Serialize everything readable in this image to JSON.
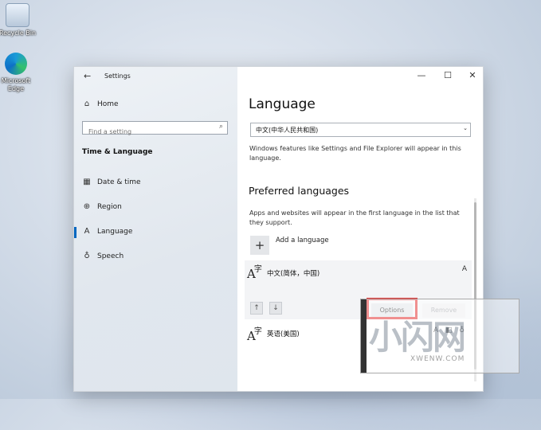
{
  "desktop": {
    "icons": [
      {
        "label": "Recycle Bin"
      },
      {
        "label": "Microsoft Edge"
      }
    ]
  },
  "window": {
    "title": "Settings",
    "back_symbol": "←",
    "minimize_symbol": "—",
    "maximize_symbol": "☐",
    "close_symbol": "✕"
  },
  "sidebar": {
    "home_label": "Home",
    "search_placeholder": "Find a setting",
    "section_title": "Time & Language",
    "items": [
      {
        "label": "Date & time",
        "icon": "calendar-icon",
        "glyph": "▦"
      },
      {
        "label": "Region",
        "icon": "globe-icon",
        "glyph": "⊕"
      },
      {
        "label": "Language",
        "icon": "language-icon",
        "glyph": "A"
      },
      {
        "label": "Speech",
        "icon": "microphone-icon",
        "glyph": "♁"
      }
    ],
    "active_item": "Language",
    "accent_color": "#0067c0"
  },
  "main": {
    "title": "Language",
    "display_language_value": "中文(中华人民共和国)",
    "display_language_desc": "Windows features like Settings and File Explorer will appear in this language.",
    "preferred_title": "Preferred languages",
    "preferred_desc": "Apps and websites will appear in the first language in the list that they support.",
    "add_language_label": "Add a language",
    "languages": [
      {
        "name": "中文(简体，中国)"
      },
      {
        "name": "英语(美国)"
      }
    ],
    "options_label": "Options",
    "remove_label": "Remove",
    "highlight_color": "#e02020"
  },
  "watermark": {
    "text": "小闪网",
    "url": "XWENW.COM"
  }
}
